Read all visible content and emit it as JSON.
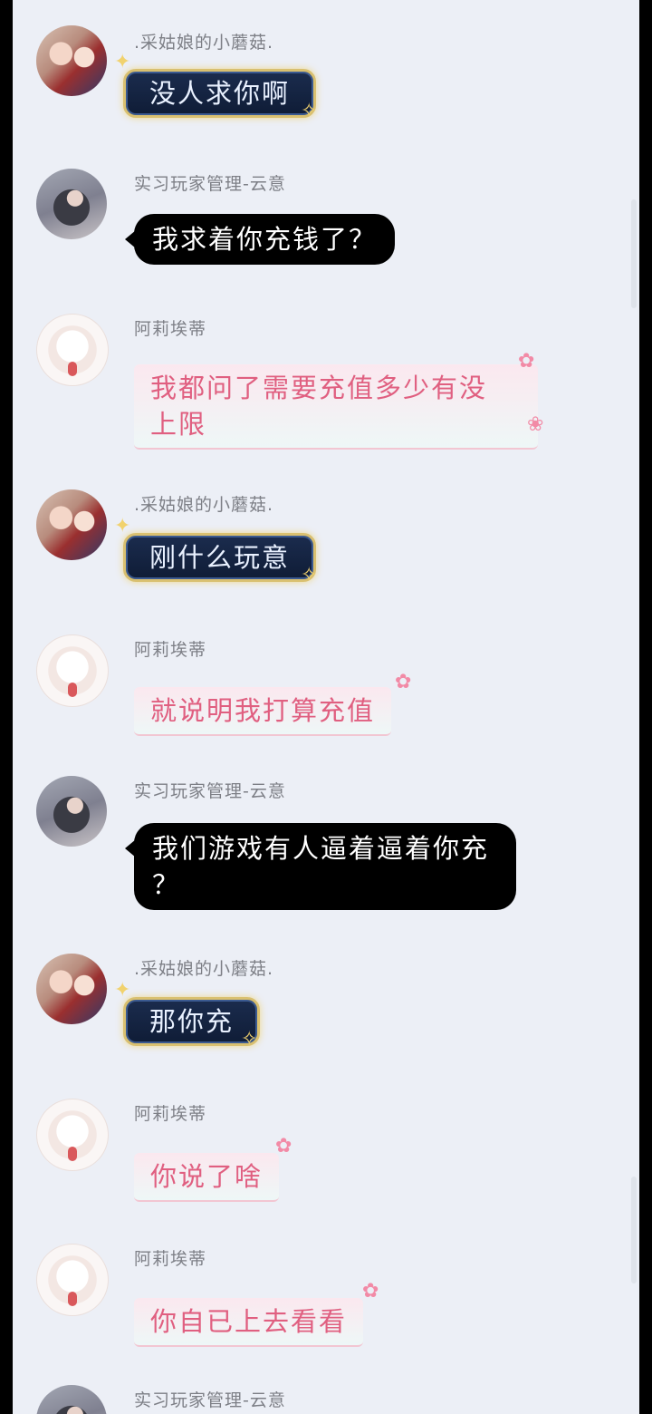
{
  "colors": {
    "dark_bubble": "#15254a",
    "pink_text": "#e05f80",
    "black_bubble": "#000000",
    "background": "#eceff6"
  },
  "messages": [
    {
      "sender": ".采姑娘的小蘑菇.",
      "text": "没人求你啊",
      "style": "dark"
    },
    {
      "sender": "实习玩家管理-云意",
      "text": "我求着你充钱了？",
      "style": "black"
    },
    {
      "sender": "阿莉埃蒂",
      "text": "我都问了需要充值多少有没上限",
      "line1": "我都问了需要充值多少有没",
      "line2": "上限",
      "style": "pink"
    },
    {
      "sender": ".采姑娘的小蘑菇.",
      "text": "刚什么玩意",
      "style": "dark"
    },
    {
      "sender": "阿莉埃蒂",
      "text": "就说明我打算充值",
      "style": "pink"
    },
    {
      "sender": "实习玩家管理-云意",
      "text": "我们游戏有人逼着逼着你充？",
      "line1": "我们游戏有人逼着逼着你充",
      "line2": "？",
      "style": "black"
    },
    {
      "sender": ".采姑娘的小蘑菇.",
      "text": "那你充",
      "style": "dark"
    },
    {
      "sender": "阿莉埃蒂",
      "text": "你说了啥",
      "style": "pink"
    },
    {
      "sender": "阿莉埃蒂",
      "text": "你自已上去看看",
      "style": "pink"
    },
    {
      "sender": "实习玩家管理-云意"
    }
  ]
}
